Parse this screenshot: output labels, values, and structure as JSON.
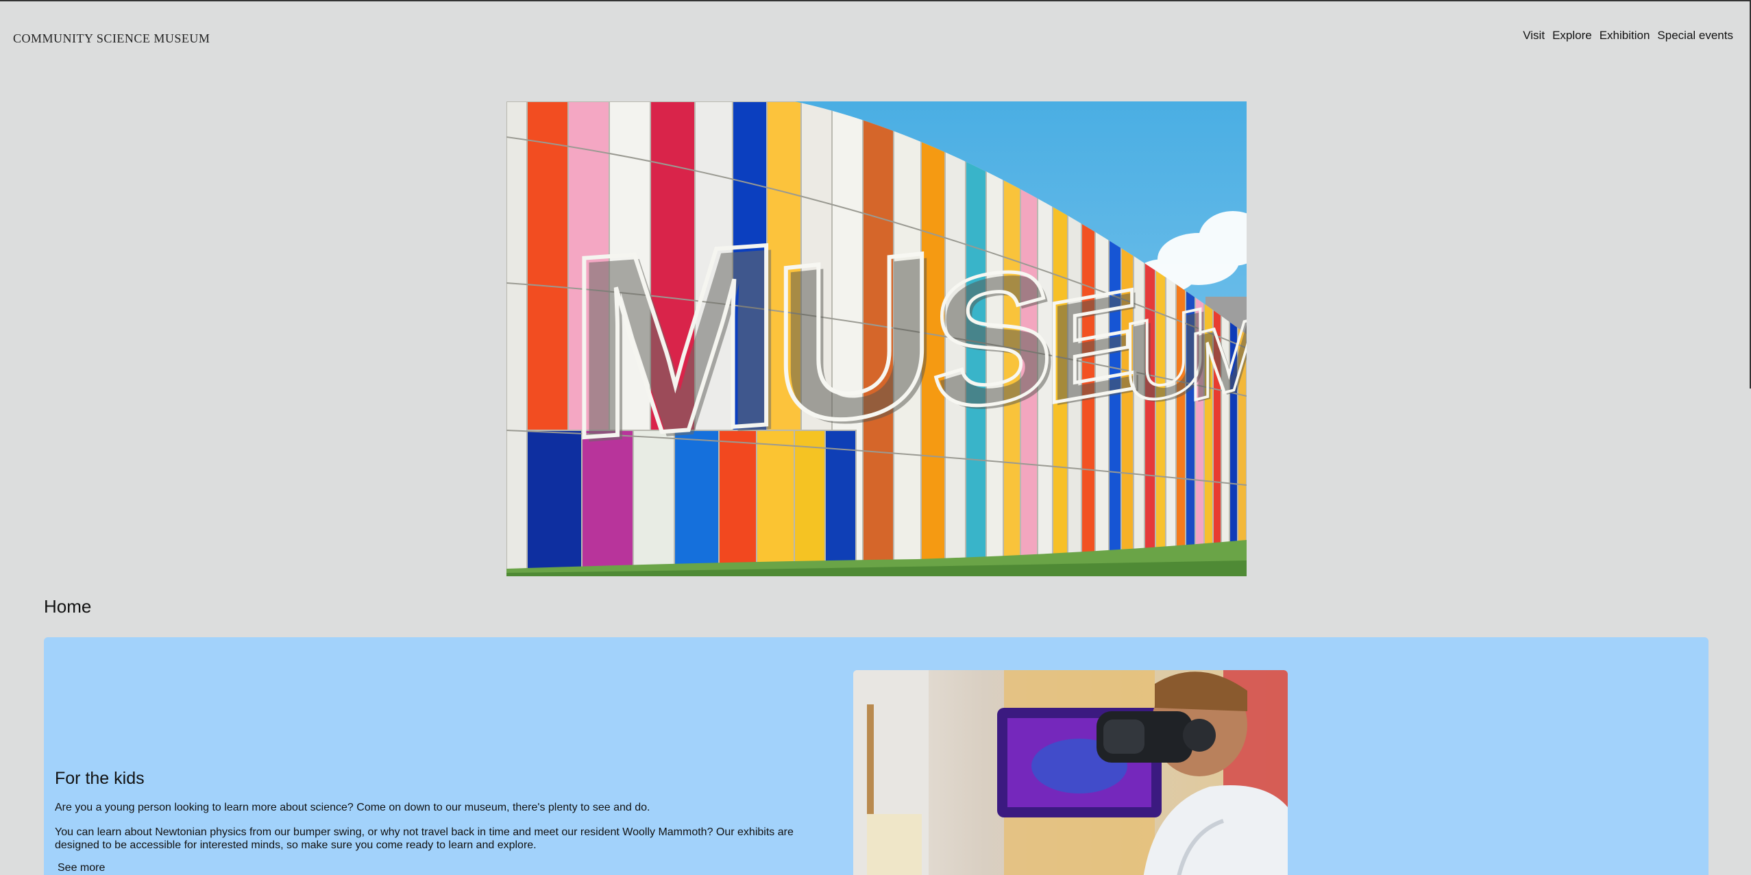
{
  "header": {
    "site_title": "COMMUNITY SCIENCE MUSEUM",
    "nav": [
      {
        "label": "Visit"
      },
      {
        "label": "Explore"
      },
      {
        "label": "Exhibition"
      },
      {
        "label": "Special events"
      }
    ]
  },
  "hero": {
    "image_subject": "colorful museum facade with large MUSEUM letters",
    "facade_text": "MUSEUM"
  },
  "home": {
    "heading": "Home"
  },
  "kids_card": {
    "background": "#a2d2fb",
    "heading": "For the kids",
    "paragraph_1": "Are you a young person looking to learn more about science? Come on down to our museum, there's plenty to see and do.",
    "paragraph_2": "You can learn about Newtonian physics from our bumper swing, or why not travel back in time and meet our resident Woolly Mammoth? Our exhibits are designed to be accessible for interested minds, so make sure you come ready to learn and explore.",
    "see_more": "See more",
    "image_subject": "person wearing a VR headset"
  },
  "colors": {
    "page_background": "#dcdddd",
    "card_background": "#a2d2fb"
  }
}
